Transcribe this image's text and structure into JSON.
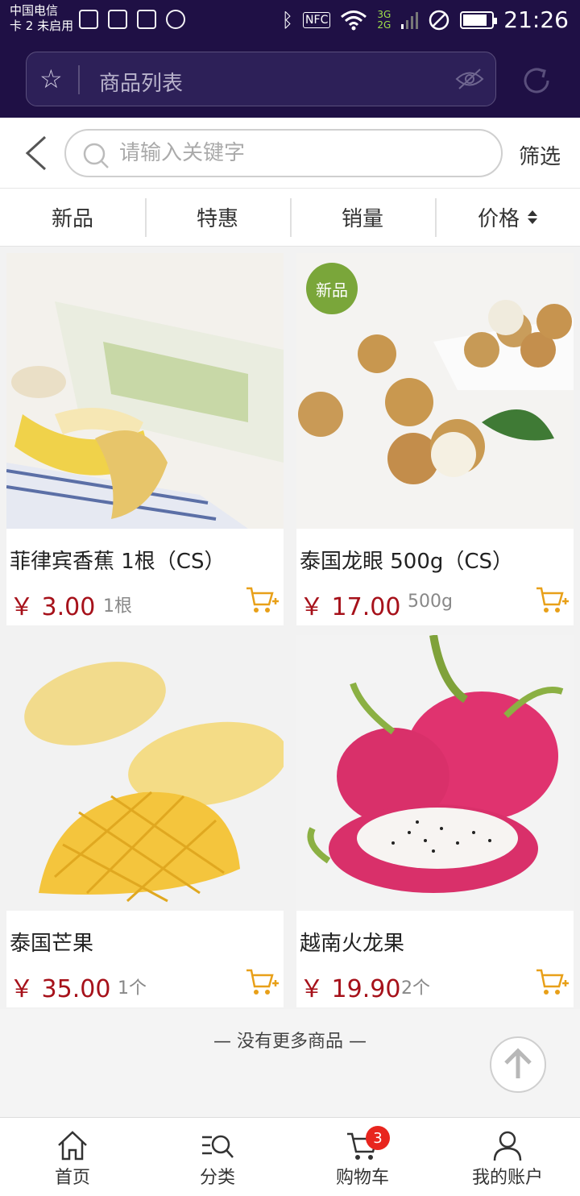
{
  "status_bar": {
    "carrier_line1": "中国电信",
    "carrier_line2": "卡 2 未启用",
    "network_3g": "3G",
    "network_2g": "2G",
    "nfc": "NFC",
    "time": "21:26",
    "battery_level": 0.85
  },
  "browser": {
    "url_text": "商品列表"
  },
  "search": {
    "placeholder": "请输入关键字",
    "filter_label": "筛选"
  },
  "sort_tabs": [
    {
      "label": "新品"
    },
    {
      "label": "特惠"
    },
    {
      "label": "销量"
    },
    {
      "label": "价格"
    }
  ],
  "products": [
    {
      "name": "菲律宾香蕉 1根（CS）",
      "price": "￥ 3.00",
      "unit": "1根",
      "badge": ""
    },
    {
      "name": "泰国龙眼 500g（CS）",
      "price": "￥ 17.00",
      "unit": "500g",
      "badge": "新品"
    },
    {
      "name": "泰国芒果",
      "price": "￥ 35.00",
      "unit": "1个",
      "badge": ""
    },
    {
      "name": "越南火龙果",
      "price": "￥ 19.90",
      "unit": "2个",
      "badge": ""
    }
  ],
  "footer_note": "— 没有更多商品 —",
  "tabbar": [
    {
      "label": "首页",
      "icon": "home-icon"
    },
    {
      "label": "分类",
      "icon": "category-search-icon"
    },
    {
      "label": "购物车",
      "icon": "cart-icon",
      "count": "3"
    },
    {
      "label": "我的账户",
      "icon": "user-icon"
    }
  ],
  "colors": {
    "header_bg": "#1f1045",
    "price_red": "#a6111a",
    "cart_orange": "#e8a019",
    "badge_green": "#7aa63a",
    "cart_badge_red": "#e8251e"
  }
}
